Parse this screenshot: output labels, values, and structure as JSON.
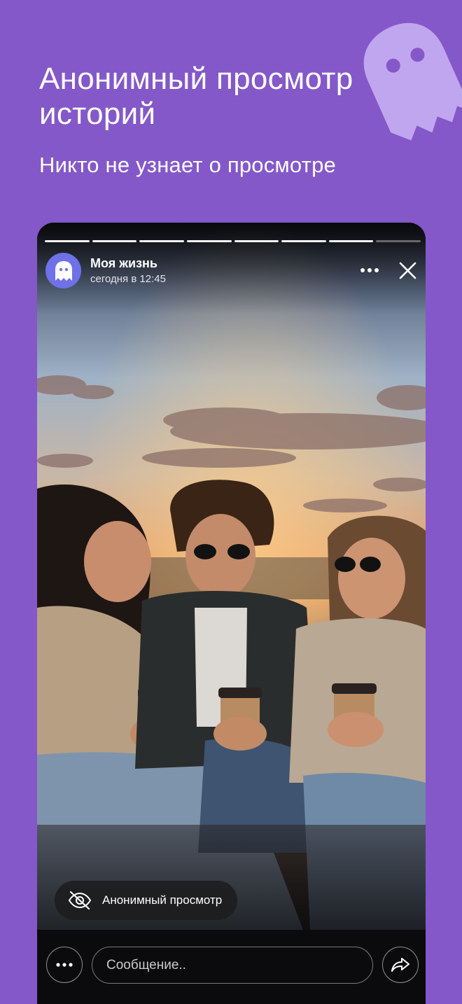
{
  "promo": {
    "title": "Анонимный просмотр историй",
    "subtitle": "Никто не узнает о просмотре"
  },
  "story": {
    "progress": {
      "segments_total": 8,
      "segments_viewed": 7
    },
    "author": "Моя жизнь",
    "timestamp": "сегодня в 12:45",
    "avatar_icon": "ghost-icon",
    "more_icon": "more-horizontal-icon",
    "close_icon": "close-icon",
    "photo_description": "three friends laughing with coffee cups at sunset"
  },
  "anonymous_badge": {
    "icon": "eye-crossed-icon",
    "label": "Анонимный просмотр"
  },
  "composer": {
    "menu_icon": "more-horizontal-icon",
    "message_placeholder": "Сообщение..",
    "share_icon": "share-arrow-icon"
  },
  "colors": {
    "background": "#8458c9",
    "ghost_deco": "#c0a6ee",
    "avatar": "#6f71e8",
    "story_bg": "#0b0b0d"
  }
}
